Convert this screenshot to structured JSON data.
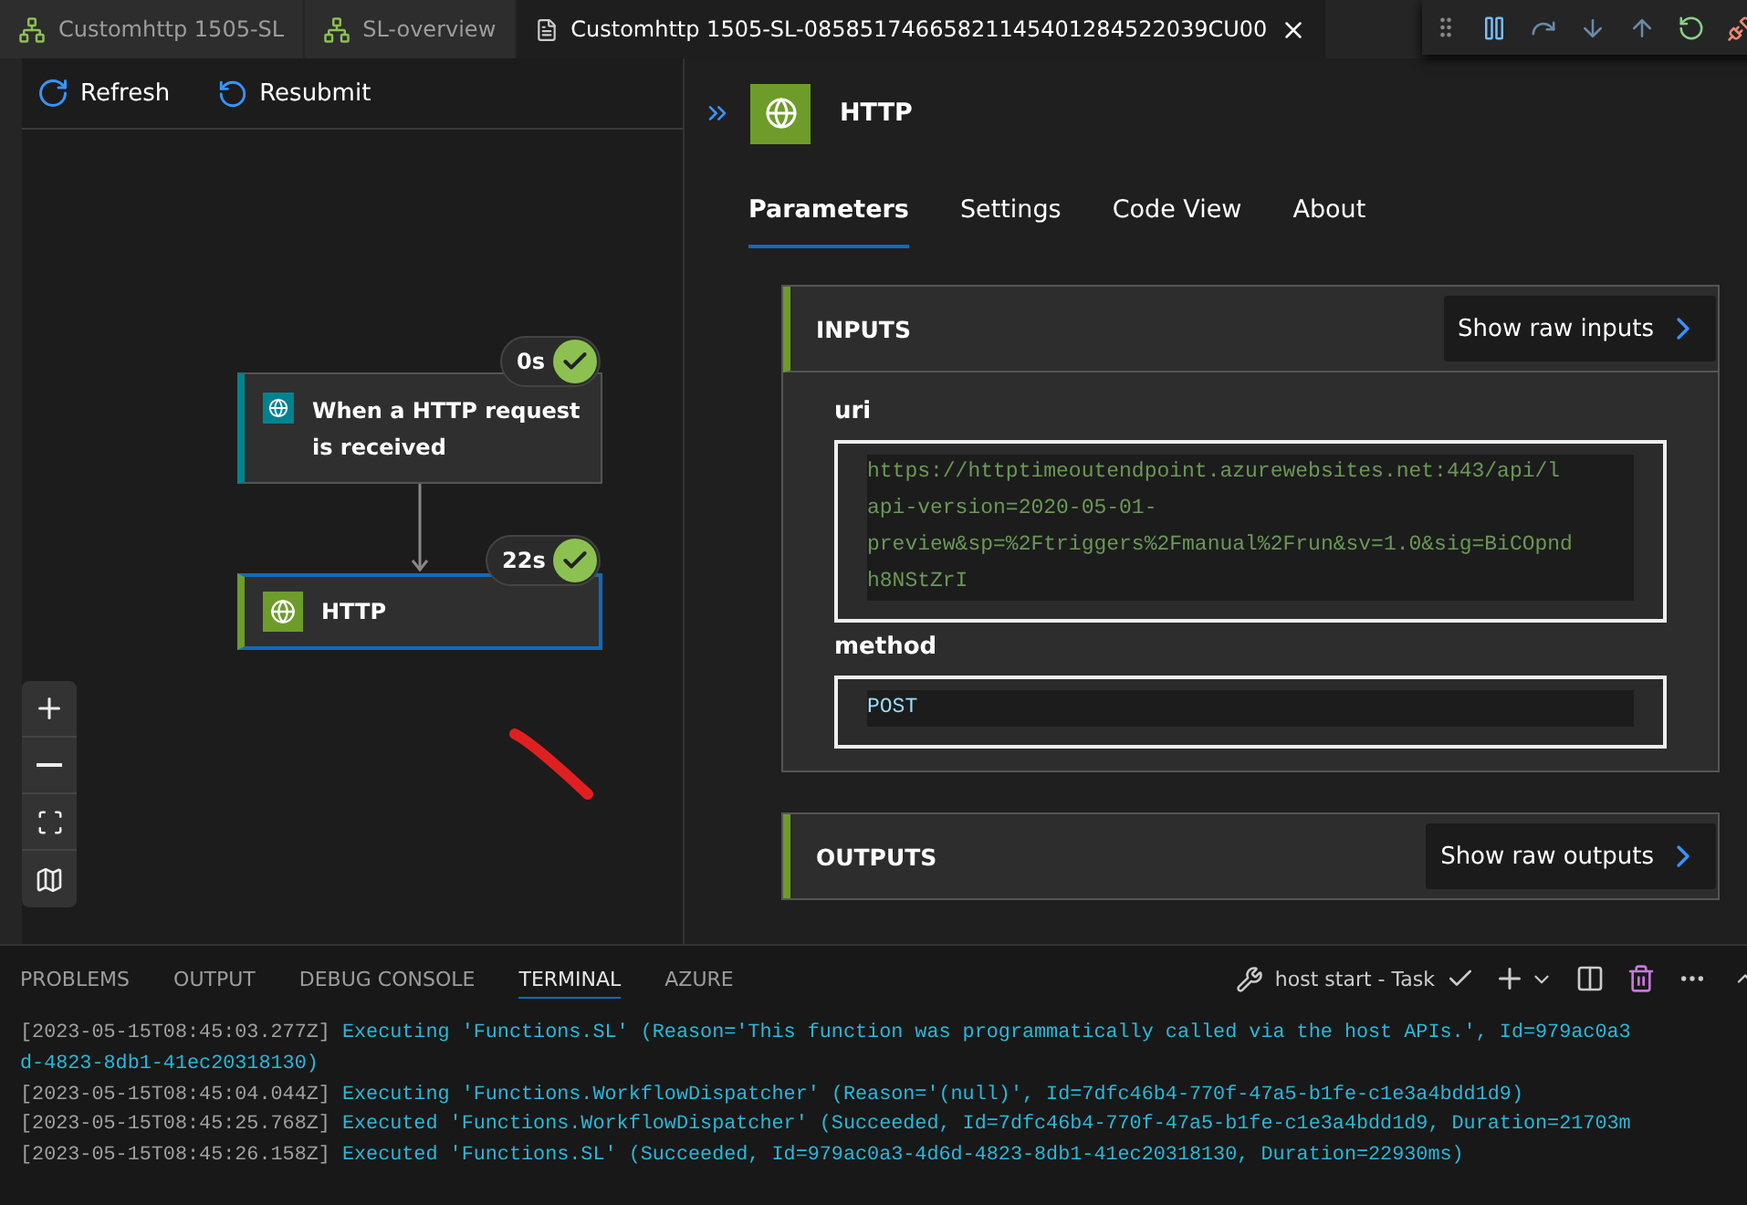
{
  "editor_tabs": [
    {
      "kind": "designer",
      "label": "Customhttp 1505-SL",
      "selected": false,
      "closable": false
    },
    {
      "kind": "designer",
      "label": "SL-overview",
      "selected": false,
      "closable": false
    },
    {
      "kind": "run",
      "label": "Customhttp 1505-SL-08585174665821145401284522039CU00",
      "selected": true,
      "closable": true
    }
  ],
  "canvas_toolbar": {
    "buttons": [
      {
        "kind": "refresh",
        "label": "Refresh"
      },
      {
        "kind": "resubmit",
        "label": "Resubmit"
      }
    ]
  },
  "workflow": {
    "nodes": [
      {
        "kind": "trigger",
        "title": "When a HTTP request is received",
        "duration": "0s",
        "succeeded": true,
        "selected": false
      },
      {
        "kind": "action",
        "title": "HTTP",
        "duration": "22s",
        "succeeded": true,
        "selected": true
      }
    ]
  },
  "details_panel": {
    "title": "HTTP",
    "tabs": [
      {
        "label": "Parameters",
        "selected": true
      },
      {
        "label": "Settings",
        "selected": false
      },
      {
        "label": "Code View",
        "selected": false
      },
      {
        "label": "About",
        "selected": false
      }
    ],
    "inputs": {
      "heading": "INPUTS",
      "raw_button": "Show raw inputs",
      "fields": [
        {
          "label": "uri",
          "lines": [
            "https://httptimeoutendpoint.azurewebsites.net:443/api/l",
            "api-version=2020-05-01-",
            "preview&sp=%2Ftriggers%2Fmanual%2Frun&sv=1.0&sig=BiCOpnd",
            "h8NStZrI"
          ]
        },
        {
          "label": "method",
          "lines": [
            "POST"
          ]
        }
      ]
    },
    "outputs": {
      "heading": "OUTPUTS",
      "raw_button": "Show raw outputs"
    }
  },
  "panel_tabs": [
    {
      "label": "PROBLEMS",
      "selected": false
    },
    {
      "label": "OUTPUT",
      "selected": false
    },
    {
      "label": "DEBUG CONSOLE",
      "selected": false
    },
    {
      "label": "TERMINAL",
      "selected": true
    },
    {
      "label": "AZURE",
      "selected": false
    }
  ],
  "terminal": {
    "task": "host start - Task",
    "lines": [
      {
        "timestamp": "[2023-05-15T08:45:03.277Z]",
        "message": "Executing 'Functions.SL' (Reason='This function was programmatically called via the host APIs.', Id=979ac0a3"
      },
      {
        "message": "d-4823-8db1-41ec20318130)"
      },
      {
        "timestamp": "[2023-05-15T08:45:04.044Z]",
        "message": "Executing 'Functions.WorkflowDispatcher' (Reason='(null)', Id=7dfc46b4-770f-47a5-b1fe-c1e3a4bdd1d9)"
      },
      {
        "timestamp": "[2023-05-15T08:45:25.768Z]",
        "message": "Executed 'Functions.WorkflowDispatcher' (Succeeded, Id=7dfc46b4-770f-47a5-b1fe-c1e3a4bdd1d9, Duration=21703m"
      },
      {
        "timestamp": "[2023-05-15T08:45:26.158Z]",
        "message": "Executed 'Functions.SL' (Succeeded, Id=979ac0a3-4d6d-4823-8db1-41ec20318130, Duration=22930ms)"
      }
    ]
  }
}
